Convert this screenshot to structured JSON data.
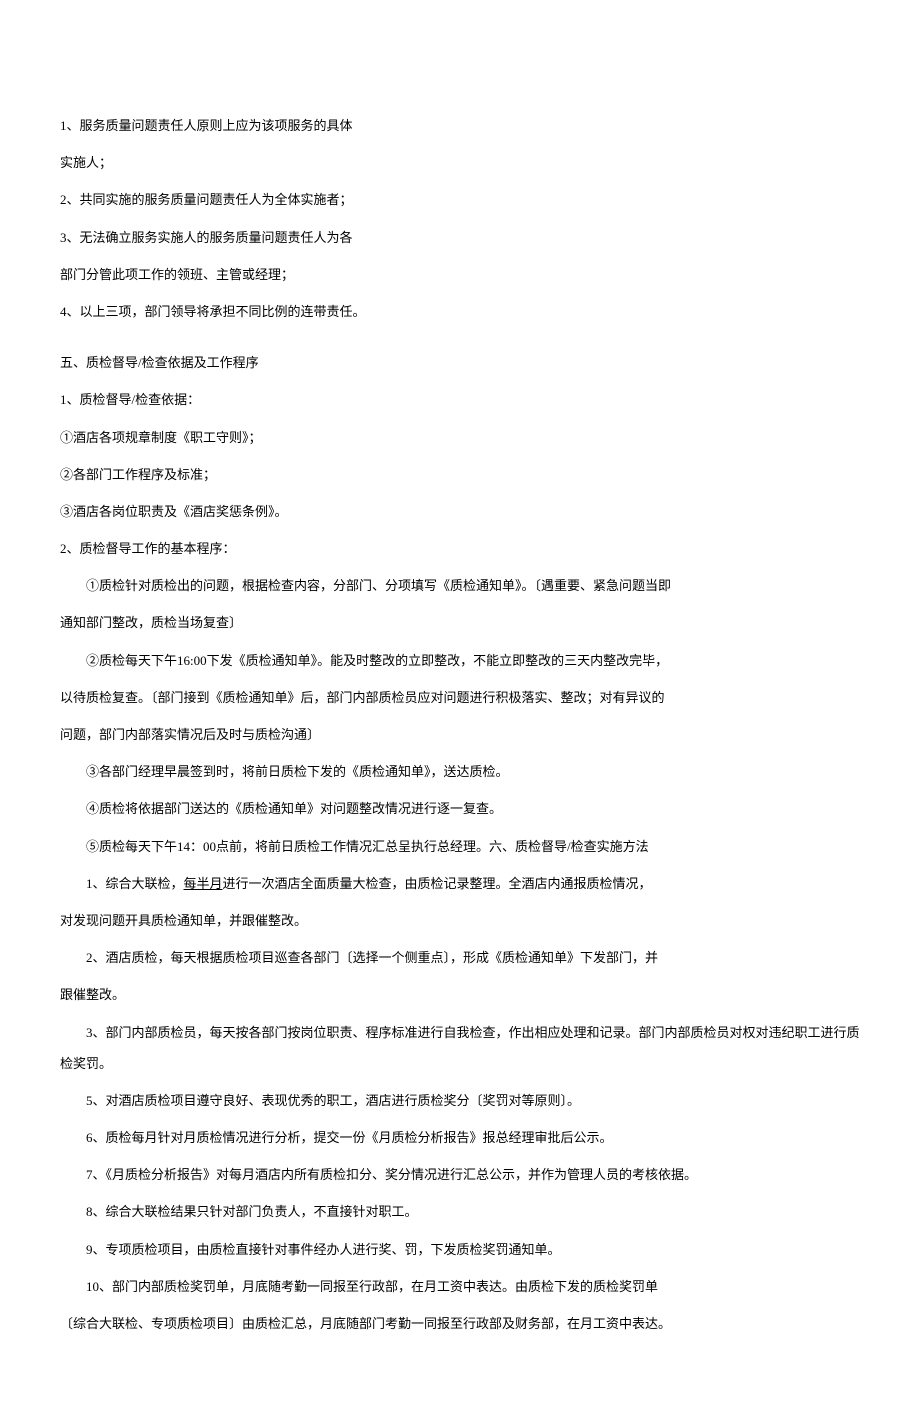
{
  "lines": {
    "l1": "1、服务质量问题责任人原则上应为该项服务的具体",
    "l2": "实施人；",
    "l3": "2、共同实施的服务质量问题责任人为全体实施者；",
    "l4": "3、无法确立服务实施人的服务质量问题责任人为各",
    "l5": "部门分管此项工作的领班、主管或经理；",
    "l6": "4、以上三项，部门领导将承担不同比例的连带责任。",
    "h5": "五、质检督导/检查依据及工作程序",
    "l7": "1、质检督导/检查依据：",
    "l8": "①酒店各项规章制度《职工守则》；",
    "l9": "②各部门工作程序及标准；",
    "l10": "③酒店各岗位职责及《酒店奖惩条例》。",
    "l11": "2、质检督导工作的基本程序：",
    "l12": "①质检针对质检出的问题，根据检查内容，分部门、分项填写《质检通知单》。〔遇重要、紧急问题当即",
    "l13": "通知部门整改，质检当场复查〕",
    "l14": "②质检每天下午16:00下发《质检通知单》。能及时整改的立即整改，不能立即整改的三天内整改完毕，",
    "l15": "以待质检复查。〔部门接到《质检通知单》后，部门内部质检员应对问题进行积极落实、整改；对有异议的",
    "l16": "问题，部门内部落实情况后及时与质检沟通〕",
    "l17": "③各部门经理早晨签到时，将前日质检下发的《质检通知单》，送达质检。",
    "l18": "④质检将依据部门送达的《质检通知单》对问题整改情况进行逐一复查。",
    "l19": "⑤质检每天下午14：00点前，将前日质检工作情况汇总呈执行总经理。六、质检督导/检查实施方法",
    "l20a": "1、综合大联检，",
    "l20u": "每半月",
    "l20b": "进行一次酒店全面质量大检查，由质检记录整理。全酒店内通报质检情况，",
    "l21": "对发现问题开具质检通知单，并跟催整改。",
    "l22": "2、酒店质检，每天根据质检项目巡查各部门〔选择一个侧重点〕，形成《质检通知单》下发部门，并",
    "l23": "跟催整改。",
    "l24": "3、部门内部质检员，每天按各部门按岗位职责、程序标准进行自我检查，作出相应处理和记录。部门内部质检员对权对违纪职工进行质检奖罚。",
    "l25": "5、对酒店质检项目遵守良好、表现优秀的职工，酒店进行质检奖分〔奖罚对等原则〕。",
    "l26": "6、质检每月针对月质检情况进行分析，提交一份《月质检分析报告》报总经理审批后公示。",
    "l27": "7、《月质检分析报告》对每月酒店内所有质检扣分、奖分情况进行汇总公示，并作为管理人员的考核依据。",
    "l28": "8、综合大联检结果只针对部门负责人，不直接针对职工。",
    "l29": "9、专项质检项目，由质检直接针对事件经办人进行奖、罚，下发质检奖罚通知单。",
    "l30": "10、部门内部质检奖罚单，月底随考勤一同报至行政部，在月工资中表达。由质检下发的质检奖罚单",
    "l31": "〔综合大联检、专项质检项目〕由质检汇总，月底随部门考勤一同报至行政部及财务部，在月工资中表达。"
  }
}
